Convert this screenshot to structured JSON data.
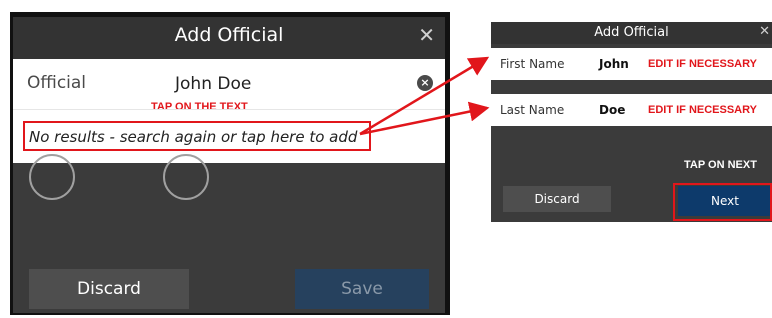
{
  "left_dialog": {
    "title": "Add Official",
    "close_icon": "close-icon",
    "official_label": "Official",
    "official_value": "John Doe",
    "clear_icon": "clear-circle-icon",
    "results_text": "No results - search again or tap here to add",
    "discard_label": "Discard",
    "save_label": "Save"
  },
  "annotations": {
    "tap_text": "TAP ON THE TEXT",
    "edit_first": "EDIT IF NECESSARY",
    "edit_last": "EDIT IF NECESSARY",
    "tap_next": "TAP ON NEXT"
  },
  "right_dialog": {
    "title": "Add Official",
    "close_icon": "close-icon",
    "first_name_label": "First Name",
    "first_name_value": "John",
    "last_name_label": "Last Name",
    "last_name_value": "Doe",
    "discard_label": "Discard",
    "next_label": "Next"
  },
  "colors": {
    "annotation_red": "#e1161b",
    "next_button": "#0d3a6b",
    "save_button": "#26415e",
    "dialog_bg": "#3b3b3b"
  }
}
